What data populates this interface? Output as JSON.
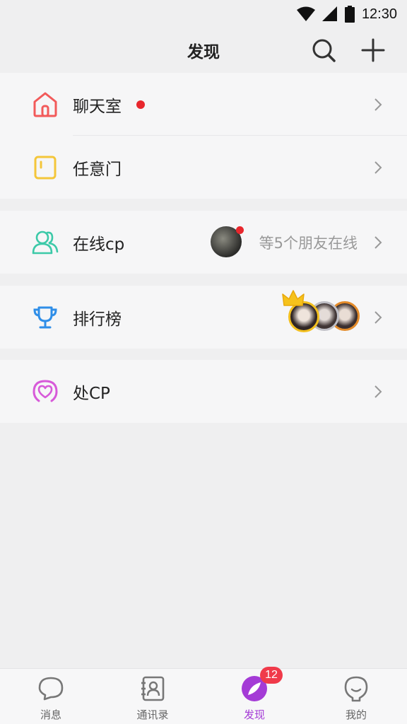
{
  "status_bar": {
    "time": "12:30"
  },
  "header": {
    "title": "发现"
  },
  "menu": {
    "chatroom": {
      "label": "聊天室"
    },
    "anydoor": {
      "label": "任意门"
    },
    "online_cp": {
      "label": "在线cp",
      "online_text": "等5个朋友在线"
    },
    "ranking": {
      "label": "排行榜"
    },
    "make_cp": {
      "label": "处CP"
    }
  },
  "tabbar": {
    "tabs": [
      {
        "label": "消息"
      },
      {
        "label": "通讯录"
      },
      {
        "label": "发现",
        "badge": "12"
      },
      {
        "label": "我的"
      }
    ]
  },
  "colors": {
    "accent": "#a43bd6",
    "badge": "#f03a4a",
    "reddot": "#e8272d"
  }
}
